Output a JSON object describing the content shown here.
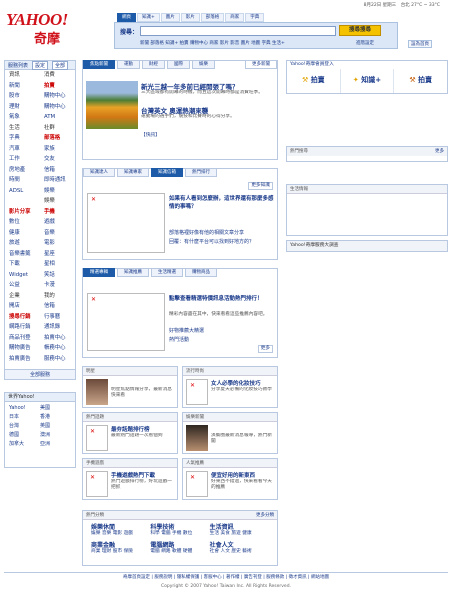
{
  "header": {
    "logo_en": "YAHOO!",
    "logo_zh": "奇摩",
    "date": "8月22日 星期三",
    "weather": "台北 27°C ~ 33°C",
    "tabs": [
      "網頁",
      "知識+",
      "圖片",
      "影片",
      "部落格",
      "商家",
      "字典"
    ],
    "search_label": "搜尋：",
    "search_button": "搜尋搜尋",
    "search_links": "新聞 部落格 知識+ 拍賣 購物中心 商家 影片 影音 圖片 地圖 字典 生活+",
    "advanced": "進階設定",
    "home": "設為首頁"
  },
  "sidebar": {
    "head": [
      "服務列表",
      "設定",
      "全部"
    ],
    "sections": [
      {
        "title": [
          "資訊",
          "消費"
        ],
        "rows": [
          [
            "新聞",
            "拍賣"
          ],
          [
            "股市",
            "購物中心"
          ],
          [
            "理財",
            "購物中心"
          ],
          [
            "氣象",
            "ATM"
          ]
        ]
      },
      {
        "title": [
          "生活",
          "社群"
        ],
        "rows": [
          [
            "字典",
            "部落格"
          ],
          [
            "汽車",
            "家族"
          ],
          [
            "工作",
            "交友"
          ],
          [
            "房地產",
            "信箱"
          ],
          [
            "時間",
            "即時通訊"
          ],
          [
            "ADSL",
            "娛樂"
          ]
        ]
      },
      {
        "title": [
          "",
          "娛樂"
        ],
        "rows": [
          [
            "影片分享",
            "手機"
          ],
          [
            "數位",
            "遊戲"
          ],
          [
            "健康",
            "音樂"
          ],
          [
            "旅遊",
            "電影"
          ],
          [
            "音樂書籤",
            "星座"
          ],
          [
            "下載",
            "星相"
          ],
          [
            "Widget",
            "笑話"
          ],
          [
            "公益",
            "卡漫"
          ]
        ]
      },
      {
        "title": [
          "企業",
          "我的"
        ],
        "rows": [
          [
            "開店",
            "信箱"
          ],
          [
            "搜尋行銷",
            "行事曆"
          ],
          [
            "網路行銷",
            "通訊錄"
          ],
          [
            "商品刊登",
            "拍賣中心"
          ],
          [
            "購物廣告",
            "帳務中心"
          ],
          [
            "拍賣廣告",
            "服務中心"
          ]
        ]
      }
    ],
    "foot": "全部服務"
  },
  "world": {
    "title": "世界Yahoo!",
    "items": [
      "Yahoo!",
      "美國",
      "日本",
      "香港",
      "台灣",
      "英國",
      "德國",
      "澳洲",
      "加拿大",
      "亞洲"
    ]
  },
  "news": {
    "tabs": [
      "焦點新聞",
      "運動",
      "財經",
      "國際",
      "娛樂"
    ],
    "more": "更多新聞",
    "hl1": "新光三越一年多前已經開張了嗎？",
    "txt1": "三大區域都有開幕的時機，而且這次開幕時都是消費旺季。",
    "hl2": "台灣英文 奧運熱潮來襲",
    "txt2": "運動場的選手們，競技和比賽時的心得分享。",
    "tail": "【快訊】"
  },
  "knowledge": {
    "tabs": [
      "知識達人",
      "知識專家",
      "知識信箱",
      "熱門排行"
    ],
    "tab_on": 2,
    "more": "更多知識",
    "hl": "如果有人看到怎麼辦，這世界還有那麼多感情的事嗎？",
    "links": [
      "部落格裡好像有他的相關文章分享",
      "回覆：有什麼平台可以找到好地方的？"
    ]
  },
  "ads": {
    "tabs": [
      "精選專輯",
      "知識推薦",
      "生活精選",
      "購物商品"
    ],
    "more": "更多",
    "hl": "點擊查看精選特價訊息活動熱門排行！",
    "txt": "精彩內容盡在其中，快來看看這些推薦內容吧。",
    "links": [
      "好物推薦大精選",
      "熱門活動"
    ]
  },
  "grid": [
    {
      "label": "明星",
      "title": "",
      "txt": "明星焦點情報分享，最新消息快來看"
    },
    {
      "label": "流行時尚",
      "title": "女人必學的化妝技巧",
      "txt": "分享夏天必備的化妝技巧教學"
    },
    {
      "label": "熱門話題",
      "title": "最夯話題排行榜",
      "txt": "最新熱門話題一次看個夠"
    },
    {
      "label": "娛樂新聞",
      "title": "",
      "txt": "演藝圈最新消息報導，熱門新聞"
    },
    {
      "label": "手機遊戲",
      "title": "手機遊戲熱門下載",
      "txt": "熱門遊戲排行榜，好玩遊戲一把抓"
    },
    {
      "label": "人氣推薦",
      "title": "便宜好用的新東西",
      "txt": "好東西不錯過，快來看看今天的推薦"
    }
  ],
  "bottom": {
    "head": "熱門分類",
    "more": "更多分類",
    "cols": [
      {
        "title": "娛樂休閒",
        "links": "娛樂 音樂 電影 遊戲"
      },
      {
        "title": "科學技術",
        "links": "科學 電腦 手機 數位"
      },
      {
        "title": "生活資訊",
        "links": "生活 美食 旅遊 健康"
      },
      {
        "title": "商業金融",
        "links": "商業 理財 股市 保險"
      },
      {
        "title": "電腦網路",
        "links": "電腦 網路 軟體 硬體"
      },
      {
        "title": "社會人文",
        "links": "社會 人文 歷史 藝術"
      }
    ]
  },
  "right": {
    "top": "Yahoo!奇摩會員登入",
    "items": [
      "拍賣",
      "知識+",
      "拍賣"
    ],
    "panel1": "熱門搜尋",
    "panel1_more": "更多",
    "panel2": "生活情報",
    "panel3": "Yahoo!奇摩服務大調查"
  },
  "footer": {
    "line1": "奇摩首頁設定 | 服務說明 | 隱私權保護 | 客服中心 | 著作權 | 廣告刊登 | 服務條款 | 徵才資訊 | 網站地圖",
    "line2": "Copyright © 2007 Yahoo! Taiwan Inc. All Rights Reserved."
  }
}
